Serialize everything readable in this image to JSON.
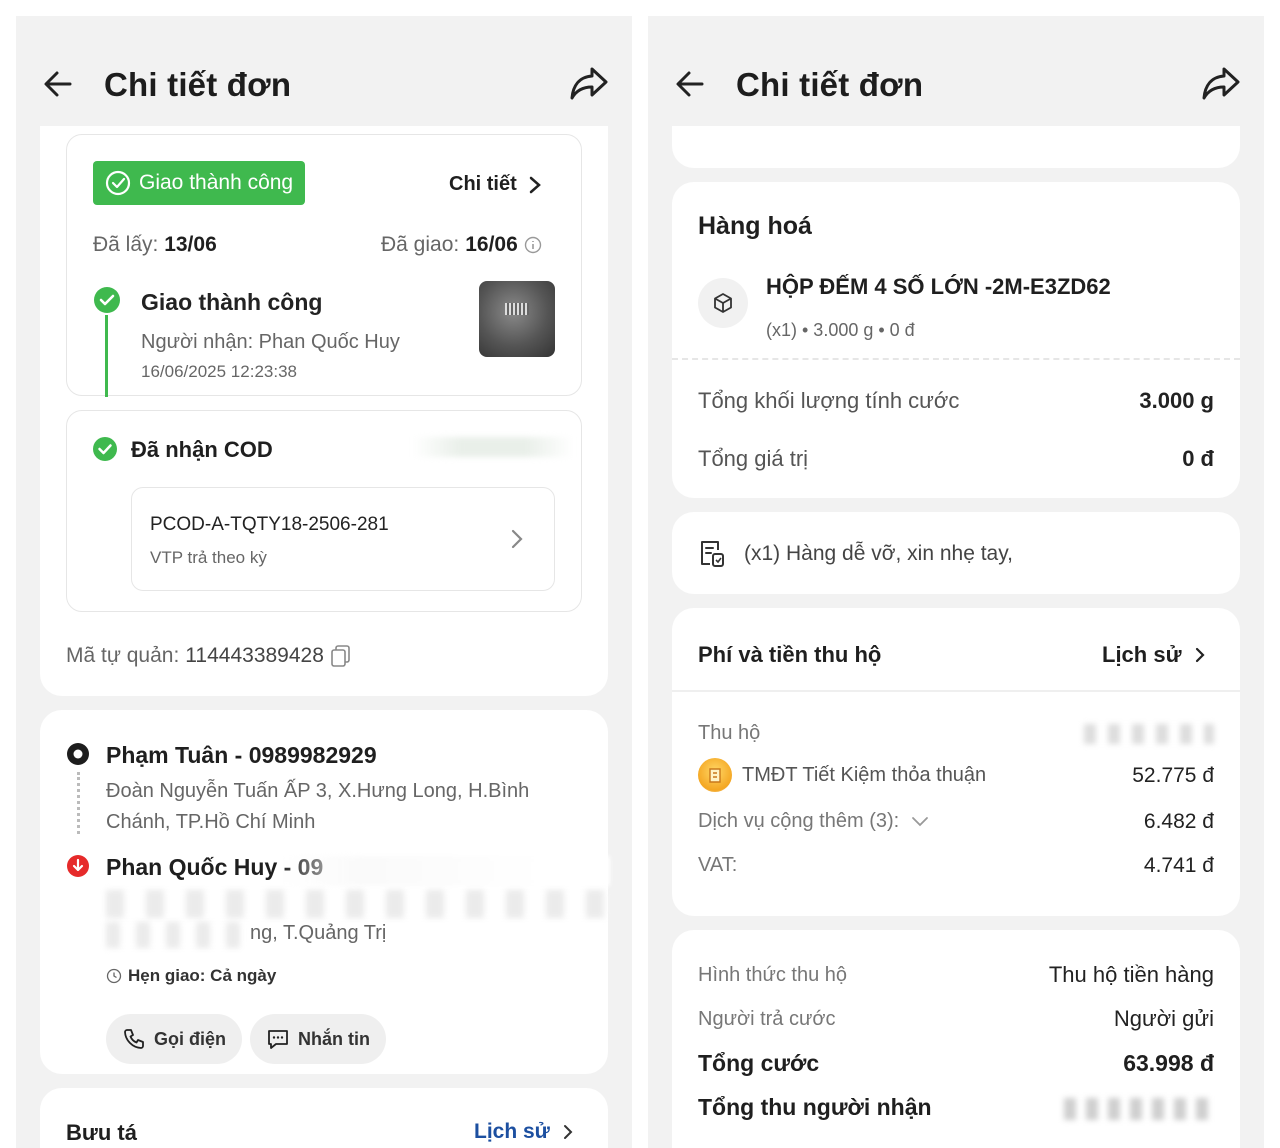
{
  "left": {
    "header": {
      "title": "Chi tiết đơn"
    },
    "status_card": {
      "status_label": "Giao thành công",
      "detail_link": "Chi tiết",
      "picked_label": "Đã lấy:",
      "picked_date": "13/06",
      "delivered_label": "Đã giao:",
      "delivered_date": "16/06",
      "timeline_title": "Giao thành công",
      "receiver_line": "Người nhận: Phan Quốc Huy",
      "timestamp": "16/06/2025 12:23:38"
    },
    "cod_card": {
      "title": "Đã nhận COD",
      "code": "PCOD-A-TQTY18-2506-281",
      "subtitle": "VTP trả theo kỳ"
    },
    "self_code": {
      "label": "Mã tự quản:",
      "value": "114443389428"
    },
    "route": {
      "sender_name": "Phạm Tuân - 0989982929",
      "sender_addr_1": "Đoàn Nguyễn Tuấn ẤP 3, X.Hưng Long, H.Bình",
      "sender_addr_2": "Chánh, TP.Hồ Chí Minh",
      "receiver_name": "Phan Quốc Huy - 09",
      "receiver_addr_2": "ng, T.Quảng Trị",
      "appointment": "Hẹn giao: Cả ngày",
      "call_label": "Gọi điện",
      "message_label": "Nhắn tin"
    },
    "postman": {
      "title": "Bưu tá",
      "history_link": "Lịch sử"
    }
  },
  "right": {
    "header": {
      "title": "Chi tiết đơn"
    },
    "goods": {
      "title": "Hàng hoá",
      "item_name": "HỘP ĐẾM 4 SỐ LỚN -2M-E3ZD62",
      "item_meta": "(x1) • 3.000 g • 0 đ",
      "weight_label": "Tổng khối lượng tính cước",
      "weight_value": "3.000 g",
      "value_label": "Tổng giá trị",
      "value_value": "0 đ"
    },
    "note": {
      "text": "(x1) Hàng dễ vỡ, xin nhẹ tay,"
    },
    "fees": {
      "title": "Phí và tiền thu hộ",
      "history_link": "Lịch sử",
      "cod_label": "Thu hộ",
      "service_label": "TMĐT Tiết Kiệm thỏa thuận",
      "service_value": "52.775 đ",
      "extra_label": "Dịch vụ cộng thêm (3):",
      "extra_value": "6.482 đ",
      "vat_label": "VAT:",
      "vat_value": "4.741 đ"
    },
    "summary": {
      "method_label": "Hình thức thu hộ",
      "method_value": "Thu hộ tiền hàng",
      "payer_label": "Người trả cước",
      "payer_value": "Người gửi",
      "total_fee_label": "Tổng cước",
      "total_fee_value": "63.998 đ",
      "total_collect_label": "Tổng thu người nhận"
    }
  }
}
